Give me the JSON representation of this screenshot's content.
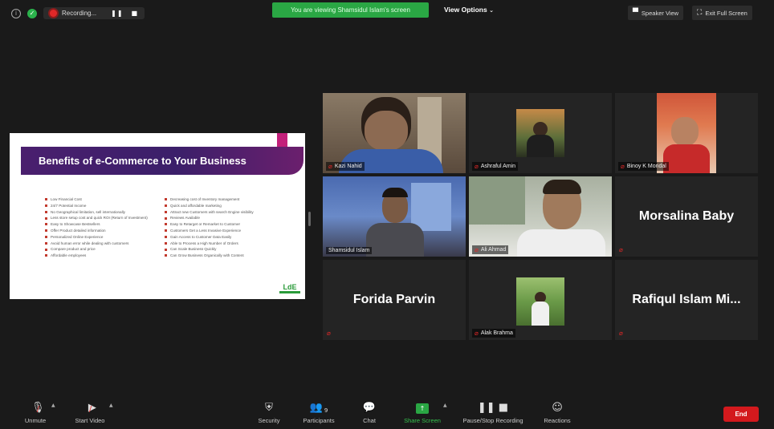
{
  "topbar": {
    "recording_label": "Recording...",
    "viewing_banner": "You are viewing Shamsidul Islam's screen",
    "view_options_label": "View Options",
    "speaker_view_label": "Speaker View",
    "exit_full_screen_label": "Exit Full Screen"
  },
  "shared_screen": {
    "slide_title": "Benefits of e-Commerce to Your Business",
    "left_bullets": [
      "Low Financial Cost",
      "24/7 Potential Income",
      "No Geographical limitation, sell internationally",
      "Less store setup cost and quick ROI (Return of Investment)",
      "Easy to Showcase Bestsellers",
      "Offer Product detailed information",
      "Personalized Online Experience",
      "Avoid human error while dealing with customers",
      "Compare product and price",
      "Affordable employees"
    ],
    "right_bullets": [
      "Decreasing cost of Inventory management",
      "Quick and affordable marketing",
      "Attract new Customers with search Engine visibility",
      "Reviews Available",
      "Easy to Retarget or Remarket to Customer",
      "Customers Get a Less Invasive Experience",
      "Gain Access to Customer Data Easily",
      "Able to Process a High Number of Orders",
      "Can Scale Business Quickly",
      "Can Grow Business Organically with Content"
    ],
    "logo_text": "LdE"
  },
  "participants": [
    {
      "name": "Kazi Nahid"
    },
    {
      "name": "Ashraful Amin"
    },
    {
      "name": "Binoy K Mondal"
    },
    {
      "name": "Shamsidul Islam"
    },
    {
      "name": "Ali Ahmad"
    },
    {
      "name": "Morsalina Baby"
    },
    {
      "name": "Forida Parvin"
    },
    {
      "name": "Alak Brahma"
    },
    {
      "name": "Rafiqul Islam Mi..."
    }
  ],
  "toolbar": {
    "unmute": "Unmute",
    "start_video": "Start Video",
    "security": "Security",
    "participants": "Participants",
    "participants_count": "9",
    "chat": "Chat",
    "share_screen": "Share Screen",
    "pause_recording": "Pause/Stop Recording",
    "reactions": "Reactions",
    "end": "End"
  },
  "colors": {
    "accent_green": "#2aa744",
    "end_red": "#d3191d",
    "active_speaker": "#d6e03a",
    "slide_purple": "#4a1f6e"
  }
}
